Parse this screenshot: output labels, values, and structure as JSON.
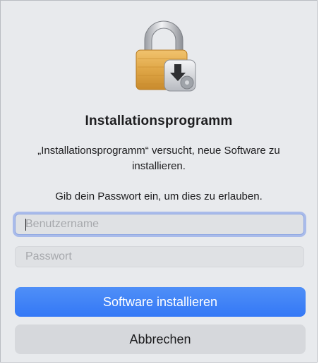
{
  "dialog": {
    "icon": "lock-with-installer-icon",
    "title": "Installationsprogramm",
    "message": "„Installationsprogramm“ versucht, neue Software zu installieren.",
    "prompt": "Gib dein Passwort ein, um dies zu erlauben.",
    "username_field": {
      "placeholder": "Benutzername",
      "value": ""
    },
    "password_field": {
      "placeholder": "Passwort",
      "value": ""
    },
    "primary_button": "Software installieren",
    "cancel_button": "Abbrechen",
    "colors": {
      "accent": "#3478f6",
      "focus_ring": "#a9bbea",
      "background": "#e8eaed"
    }
  }
}
